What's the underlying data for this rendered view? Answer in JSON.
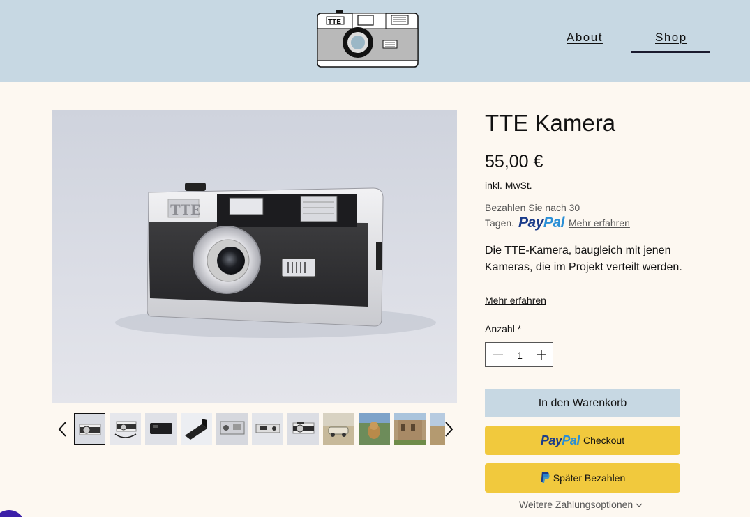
{
  "header": {
    "logo_text": "TTE",
    "nav": [
      {
        "label": "About"
      },
      {
        "label": "Shop"
      }
    ]
  },
  "product": {
    "title": "TTE Kamera",
    "price": "55,00 €",
    "tax_note": "inkl. MwSt.",
    "paypal_message": {
      "line1": "Bezahlen Sie nach 30",
      "line2_prefix": "Tagen.",
      "logo_pay": "Pay",
      "logo_pal": "Pal",
      "link": "Mehr erfahren"
    },
    "description": "Die TTE-Kamera, baugleich mit jenen Kameras, die im Projekt verteilt werden.",
    "more_link": "Mehr erfahren",
    "quantity_label": "Anzahl *",
    "quantity_value": "1",
    "add_to_cart": "In den Warenkorb",
    "paypal_checkout": "Checkout",
    "paypal_later": "Später Bezahlen",
    "more_payment_options": "Weitere Zahlungsoptionen"
  },
  "gallery": {
    "thumbnails": [
      "camera-front",
      "camera-strap",
      "camera-black",
      "camera-open",
      "camera-back",
      "camera-top",
      "camera-angle",
      "car-photo",
      "dog-photo",
      "building-photo",
      "landscape-photo"
    ],
    "selected_index": 0
  },
  "colors": {
    "header_bg": "#c7d8e3",
    "page_bg": "#fdf8f1",
    "paypal_yellow": "#f1c93d",
    "paypal_dark_blue": "#1b3c8a",
    "paypal_light_blue": "#2a8fd6"
  }
}
